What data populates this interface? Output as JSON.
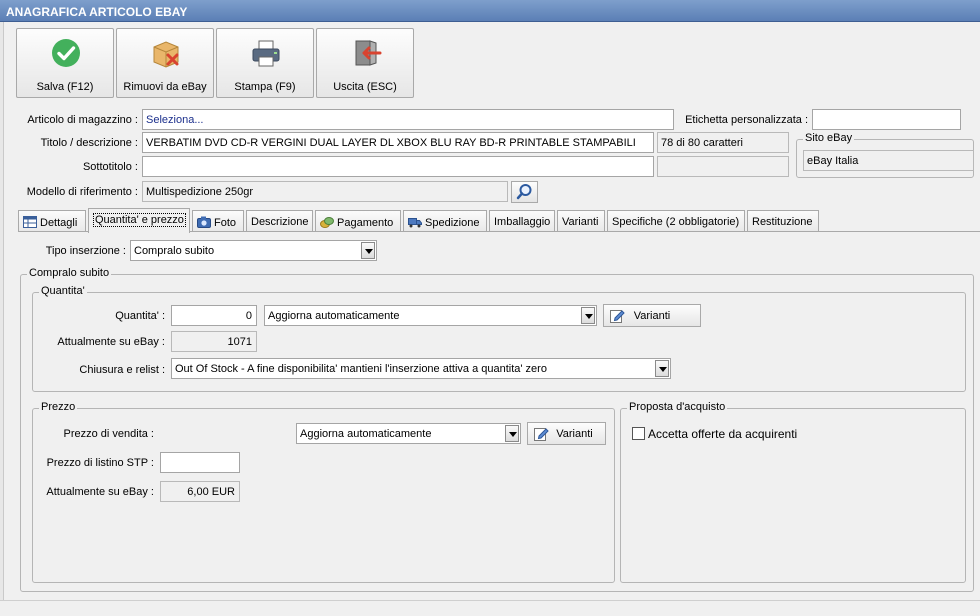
{
  "window": {
    "title": "ANAGRAFICA ARTICOLO EBAY"
  },
  "toolbar": {
    "save_label": "Salva (F12)",
    "remove_label": "Rimuovi da eBay",
    "print_label": "Stampa (F9)",
    "exit_label": "Uscita (ESC)"
  },
  "form": {
    "articolo_label": "Articolo di magazzino :",
    "articolo_value": "Seleziona...",
    "etichetta_label": "Etichetta personalizzata :",
    "etichetta_value": "",
    "titolo_label": "Titolo / descrizione :",
    "titolo_value": "VERBATIM DVD CD-R VERGINI DUAL LAYER DL XBOX BLU RAY BD-R PRINTABLE STAMPABILI",
    "titolo_counter": "78 di 80 caratteri",
    "sottotitolo_label": "Sottotitolo :",
    "sottotitolo_value": "",
    "modello_label": "Modello di riferimento :",
    "modello_value": "Multispedizione 250gr",
    "sito_group_title": "Sito eBay",
    "sito_value": "eBay Italia"
  },
  "tabs": [
    {
      "label": "Dettagli",
      "icon": "table-icon"
    },
    {
      "label": "Quantita' e prezzo",
      "icon": ""
    },
    {
      "label": "Foto",
      "icon": "camera-icon"
    },
    {
      "label": "Descrizione",
      "icon": ""
    },
    {
      "label": "Pagamento",
      "icon": "coins-icon"
    },
    {
      "label": "Spedizione",
      "icon": "truck-icon"
    },
    {
      "label": "Imballaggio",
      "icon": ""
    },
    {
      "label": "Varianti",
      "icon": ""
    },
    {
      "label": "Specifiche (2 obbligatorie)",
      "icon": ""
    },
    {
      "label": "Restituzione",
      "icon": ""
    }
  ],
  "active_tab": "Quantita' e prezzo",
  "tipo": {
    "label": "Tipo inserzione :",
    "value": "Compralo subito"
  },
  "compralo_group_title": "Compralo subito",
  "quantita": {
    "group_title": "Quantita'",
    "quantita_label": "Quantita' :",
    "quantita_value": "0",
    "aggiorna_value": "Aggiorna automaticamente",
    "varianti_label": "Varianti",
    "attuale_label": "Attualmente su eBay :",
    "attuale_value": "1071",
    "chiusura_label": "Chiusura e relist :",
    "chiusura_value": "Out Of Stock - A fine disponibilita' mantieni l'inserzione attiva a quantita' zero"
  },
  "prezzo": {
    "group_title": "Prezzo",
    "vendita_label": "Prezzo di vendita :",
    "aggiorna_value": "Aggiorna automaticamente",
    "varianti_label": "Varianti",
    "listino_label": "Prezzo di listino STP :",
    "listino_value": "",
    "attuale_label": "Attualmente su eBay :",
    "attuale_value": "6,00 EUR"
  },
  "proposta": {
    "group_title": "Proposta d'acquisto",
    "accetta_label": "Accetta offerte da acquirenti",
    "accetta_checked": false
  },
  "colors": {
    "titlebar": "#5b7fb5",
    "save_green": "#43b05c",
    "exit_red": "#d9432f"
  }
}
